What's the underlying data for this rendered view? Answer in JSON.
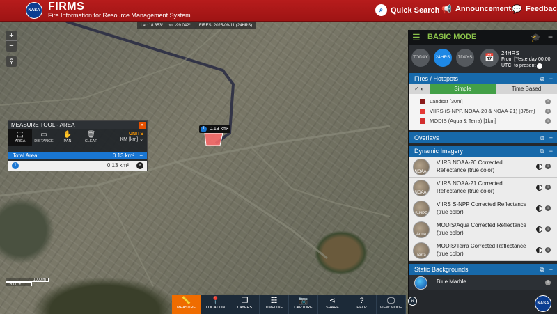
{
  "header": {
    "logo_text": "NASA",
    "title": "FIRMS",
    "subtitle": "Fire Information for Resource Management System",
    "quick_search": "Quick Search",
    "announcements": "Announcements",
    "feedback": "Feedback",
    "brand_color": "#b71c1c"
  },
  "coords": {
    "lat_lon": "Lat: 18.353°, Lon: -99.042°",
    "fires": "FIRES: 2025-09-11 (24HRS)"
  },
  "map_controls": {
    "zoom_in": "+",
    "zoom_out": "−",
    "locate_icon": "map-pin-icon"
  },
  "measure_tool": {
    "title": "MEASURE TOOL - AREA",
    "close": "×",
    "tools": [
      "AREA",
      "DISTANCE",
      "PAN",
      "CLEAR"
    ],
    "units_label": "UNITS",
    "units_value": "KM [km]",
    "total_label": "Total Area:",
    "total_value": "0.13 km²",
    "area_index": "1",
    "area_value": "0.13 km²"
  },
  "map_label": {
    "index": "1",
    "value": "0.13 km²"
  },
  "scale": {
    "top": "1000 m",
    "bottom": "2000 ft"
  },
  "panel": {
    "mode": "BASIC MODE",
    "time_buttons": [
      "TODAY",
      "24HRS",
      "7DAYS"
    ],
    "active_time": "24HRS",
    "range_title": "24HRS",
    "range_line1": "From [Yesterday 00:00",
    "range_line2": "UTC] to present",
    "fires_section": {
      "title": "Fires / Hotspots",
      "tab_simple": "Simple",
      "tab_time": "Time Based",
      "items": [
        {
          "label": "Landsat [30m]",
          "color": "#8b1a1a"
        },
        {
          "label": "VIIRS (S-NPP, NOAA-20 & NOAA-21) [375m]",
          "color": "#e53935"
        },
        {
          "label": "MODIS (Aqua & Terra) [1km]",
          "color": "#d32f2f"
        }
      ]
    },
    "overlays_title": "Overlays",
    "imagery_title": "Dynamic Imagery",
    "imagery": [
      {
        "label": "VIIRS NOAA-20 Corrected Reflectance (true color)",
        "thumb": "NOAA-20"
      },
      {
        "label": "VIIRS NOAA-21 Corrected Reflectance (true color)",
        "thumb": "NOAA-21"
      },
      {
        "label": "VIIRS S-NPP Corrected Reflectance (true color)",
        "thumb": "S-NPP"
      },
      {
        "label": "MODIS/Aqua Corrected Reflectance (true color)",
        "thumb": "Aqua"
      },
      {
        "label": "MODIS/Terra Corrected Reflectance (true color)",
        "thumb": "Terra"
      }
    ],
    "backgrounds_title": "Static Backgrounds",
    "background_item": "Blue Marble"
  },
  "toolbar": {
    "tools": [
      {
        "label": "MEASURE",
        "icon": "ruler-icon"
      },
      {
        "label": "LOCATION",
        "icon": "location-icon"
      },
      {
        "label": "LAYERS",
        "icon": "layers-icon"
      },
      {
        "label": "TIMELINE",
        "icon": "timeline-icon"
      },
      {
        "label": "CAPTURE",
        "icon": "camera-icon"
      },
      {
        "label": "SHARE",
        "icon": "share-icon"
      },
      {
        "label": "HELP",
        "icon": "help-icon"
      },
      {
        "label": "VIEW MODE",
        "icon": "monitor-icon"
      }
    ],
    "active": "MEASURE",
    "close": "×",
    "active_color": "#ef6c00"
  }
}
